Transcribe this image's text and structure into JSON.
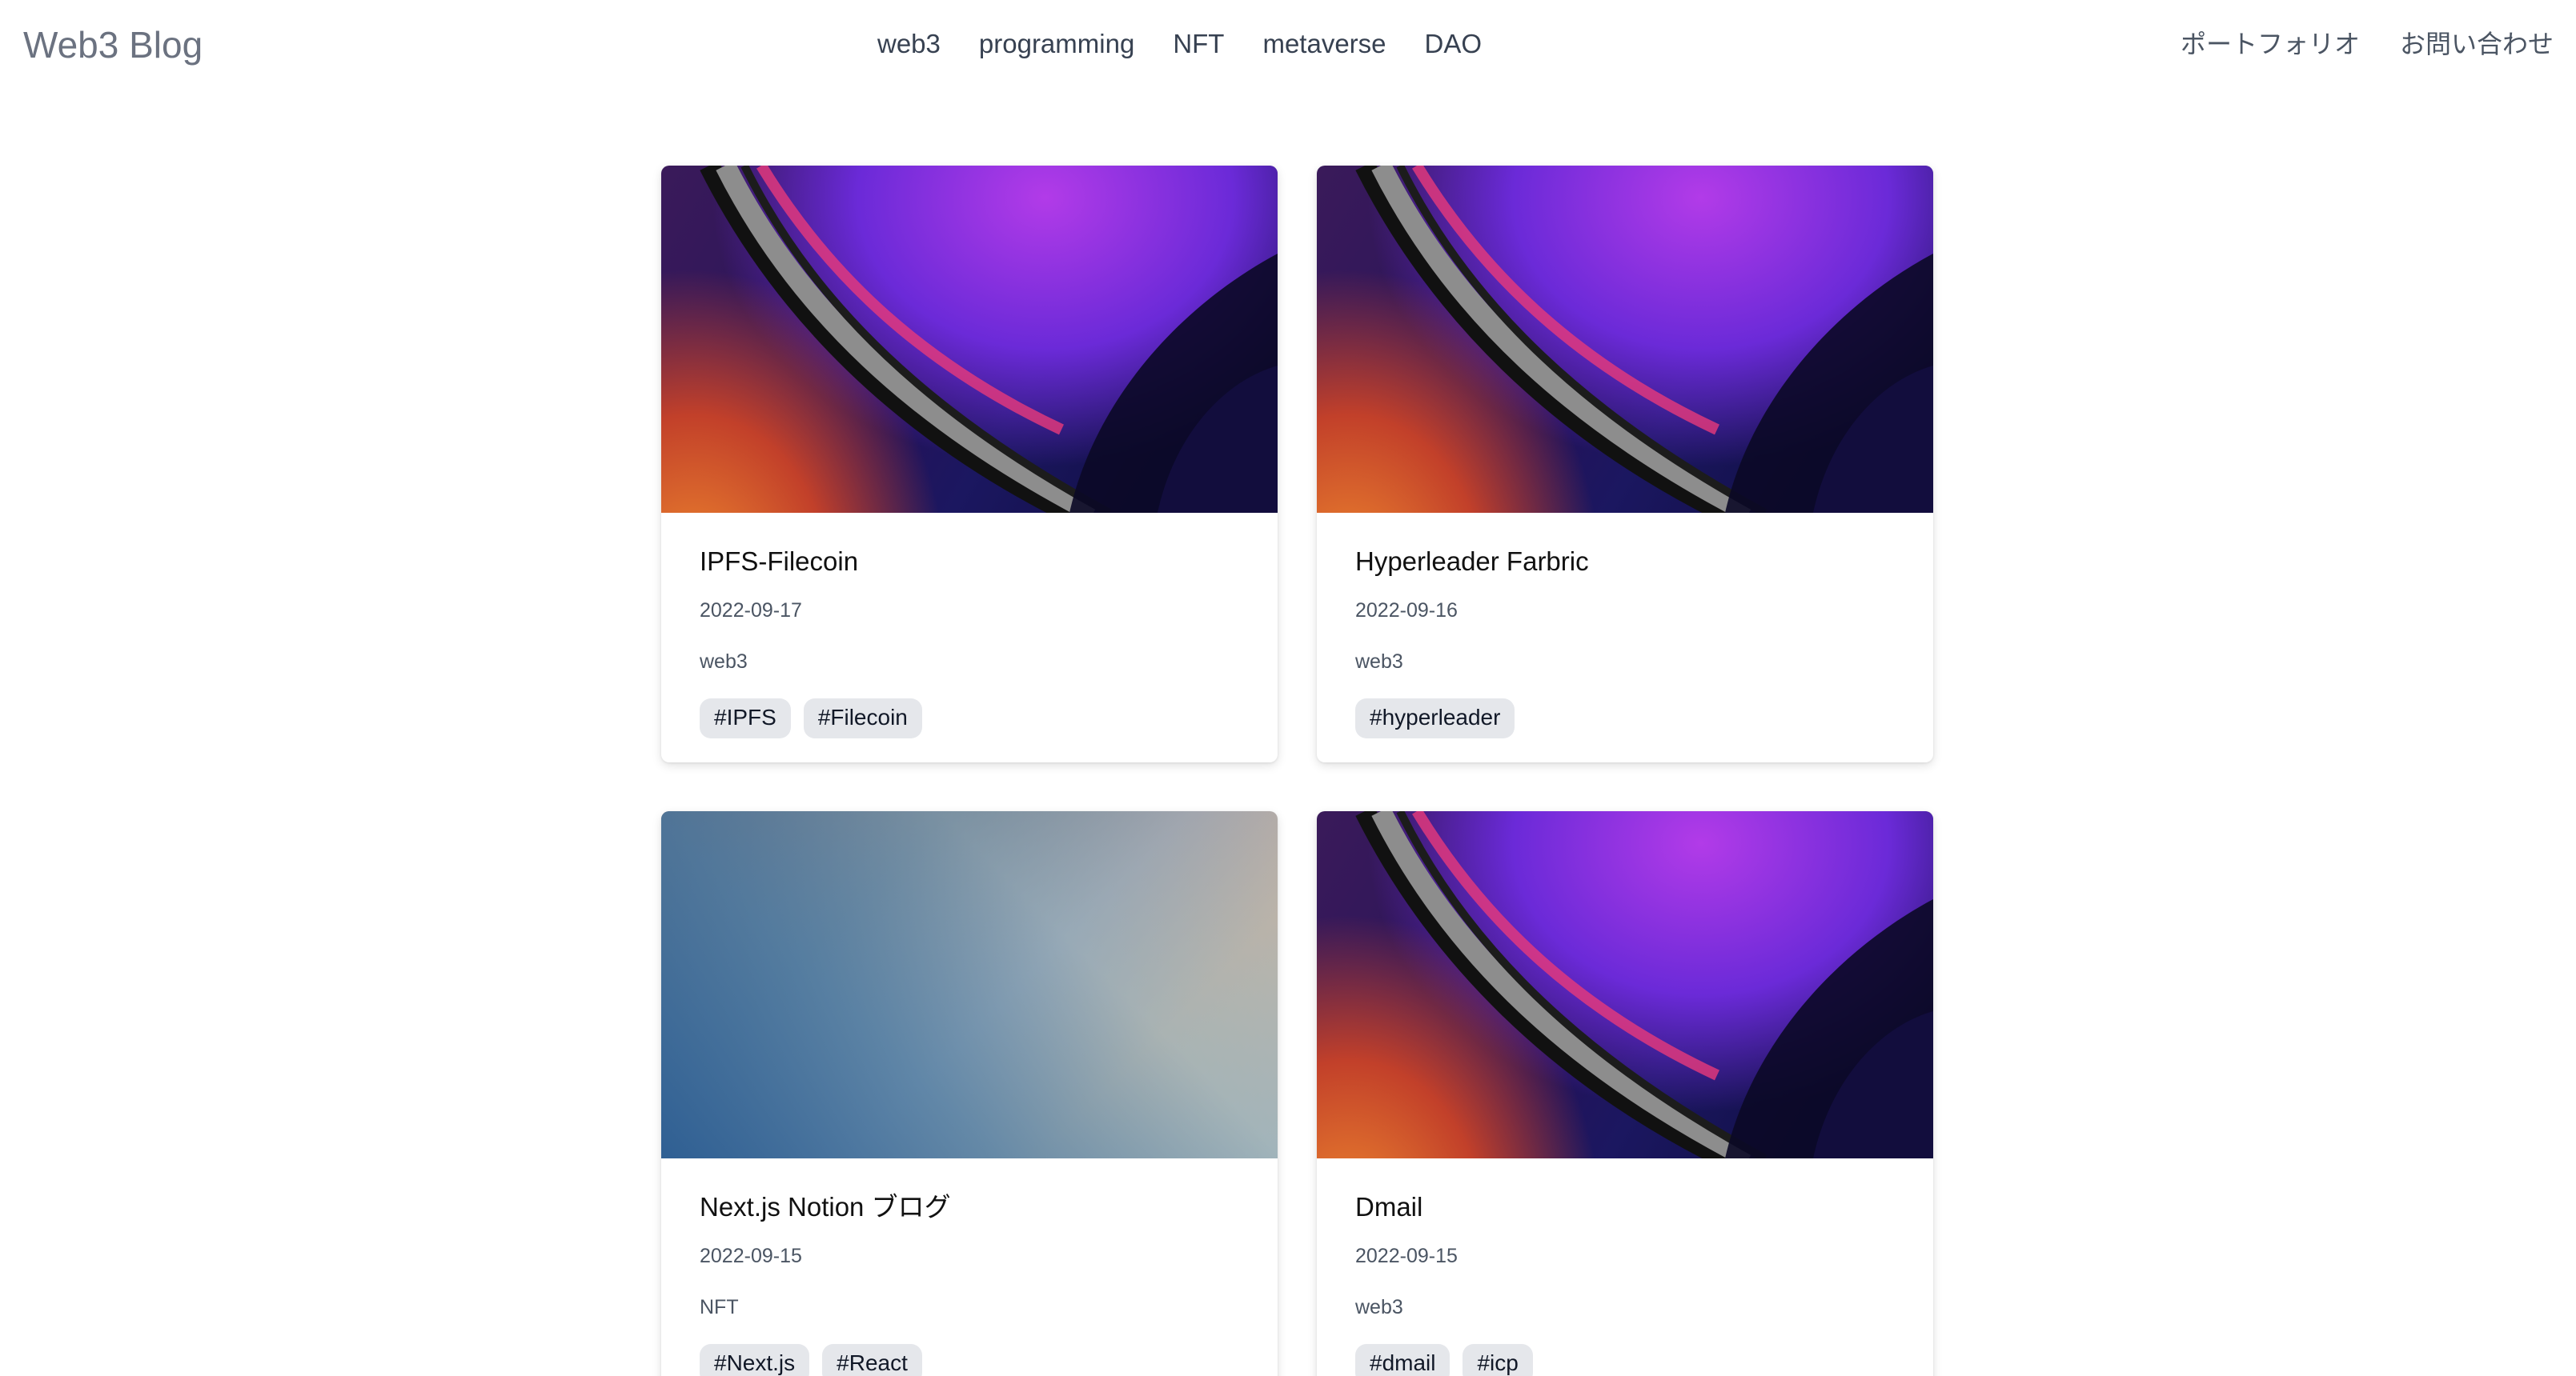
{
  "header": {
    "brand": "Web3 Blog",
    "nav": [
      "web3",
      "programming",
      "NFT",
      "metaverse",
      "DAO"
    ],
    "right_nav": [
      "ポートフォリオ",
      "お問い合わせ"
    ]
  },
  "posts": [
    {
      "title": "IPFS-Filecoin",
      "date": "2022-09-17",
      "category": "web3",
      "tags": [
        "#IPFS",
        "#Filecoin"
      ],
      "image": "abstract-purple-orange-wallpaper"
    },
    {
      "title": "Hyperleader Farbric",
      "date": "2022-09-16",
      "category": "web3",
      "tags": [
        "#hyperleader"
      ],
      "image": "abstract-purple-orange-wallpaper"
    },
    {
      "title": "Next.js Notion ブログ",
      "date": "2022-09-15",
      "category": "NFT",
      "tags": [
        "#Next.js",
        "#React"
      ],
      "image": "blue-beige-gradient"
    },
    {
      "title": "Dmail",
      "date": "2022-09-15",
      "category": "web3",
      "tags": [
        "#dmail",
        "#icp"
      ],
      "image": "abstract-purple-orange-wallpaper"
    }
  ]
}
